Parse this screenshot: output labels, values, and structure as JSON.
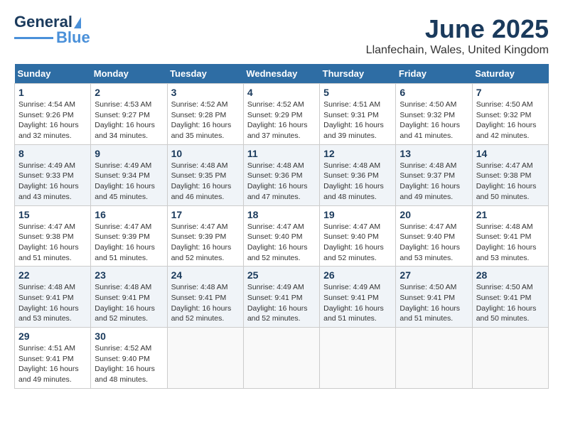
{
  "header": {
    "logo_general": "General",
    "logo_blue": "Blue",
    "month_title": "June 2025",
    "location": "Llanfechain, Wales, United Kingdom"
  },
  "weekdays": [
    "Sunday",
    "Monday",
    "Tuesday",
    "Wednesday",
    "Thursday",
    "Friday",
    "Saturday"
  ],
  "weeks": [
    [
      {
        "day": "1",
        "sunrise": "4:54 AM",
        "sunset": "9:26 PM",
        "daylight": "16 hours and 32 minutes."
      },
      {
        "day": "2",
        "sunrise": "4:53 AM",
        "sunset": "9:27 PM",
        "daylight": "16 hours and 34 minutes."
      },
      {
        "day": "3",
        "sunrise": "4:52 AM",
        "sunset": "9:28 PM",
        "daylight": "16 hours and 35 minutes."
      },
      {
        "day": "4",
        "sunrise": "4:52 AM",
        "sunset": "9:29 PM",
        "daylight": "16 hours and 37 minutes."
      },
      {
        "day": "5",
        "sunrise": "4:51 AM",
        "sunset": "9:31 PM",
        "daylight": "16 hours and 39 minutes."
      },
      {
        "day": "6",
        "sunrise": "4:50 AM",
        "sunset": "9:32 PM",
        "daylight": "16 hours and 41 minutes."
      },
      {
        "day": "7",
        "sunrise": "4:50 AM",
        "sunset": "9:32 PM",
        "daylight": "16 hours and 42 minutes."
      }
    ],
    [
      {
        "day": "8",
        "sunrise": "4:49 AM",
        "sunset": "9:33 PM",
        "daylight": "16 hours and 43 minutes."
      },
      {
        "day": "9",
        "sunrise": "4:49 AM",
        "sunset": "9:34 PM",
        "daylight": "16 hours and 45 minutes."
      },
      {
        "day": "10",
        "sunrise": "4:48 AM",
        "sunset": "9:35 PM",
        "daylight": "16 hours and 46 minutes."
      },
      {
        "day": "11",
        "sunrise": "4:48 AM",
        "sunset": "9:36 PM",
        "daylight": "16 hours and 47 minutes."
      },
      {
        "day": "12",
        "sunrise": "4:48 AM",
        "sunset": "9:36 PM",
        "daylight": "16 hours and 48 minutes."
      },
      {
        "day": "13",
        "sunrise": "4:48 AM",
        "sunset": "9:37 PM",
        "daylight": "16 hours and 49 minutes."
      },
      {
        "day": "14",
        "sunrise": "4:47 AM",
        "sunset": "9:38 PM",
        "daylight": "16 hours and 50 minutes."
      }
    ],
    [
      {
        "day": "15",
        "sunrise": "4:47 AM",
        "sunset": "9:38 PM",
        "daylight": "16 hours and 51 minutes."
      },
      {
        "day": "16",
        "sunrise": "4:47 AM",
        "sunset": "9:39 PM",
        "daylight": "16 hours and 51 minutes."
      },
      {
        "day": "17",
        "sunrise": "4:47 AM",
        "sunset": "9:39 PM",
        "daylight": "16 hours and 52 minutes."
      },
      {
        "day": "18",
        "sunrise": "4:47 AM",
        "sunset": "9:40 PM",
        "daylight": "16 hours and 52 minutes."
      },
      {
        "day": "19",
        "sunrise": "4:47 AM",
        "sunset": "9:40 PM",
        "daylight": "16 hours and 52 minutes."
      },
      {
        "day": "20",
        "sunrise": "4:47 AM",
        "sunset": "9:40 PM",
        "daylight": "16 hours and 53 minutes."
      },
      {
        "day": "21",
        "sunrise": "4:48 AM",
        "sunset": "9:41 PM",
        "daylight": "16 hours and 53 minutes."
      }
    ],
    [
      {
        "day": "22",
        "sunrise": "4:48 AM",
        "sunset": "9:41 PM",
        "daylight": "16 hours and 53 minutes."
      },
      {
        "day": "23",
        "sunrise": "4:48 AM",
        "sunset": "9:41 PM",
        "daylight": "16 hours and 52 minutes."
      },
      {
        "day": "24",
        "sunrise": "4:48 AM",
        "sunset": "9:41 PM",
        "daylight": "16 hours and 52 minutes."
      },
      {
        "day": "25",
        "sunrise": "4:49 AM",
        "sunset": "9:41 PM",
        "daylight": "16 hours and 52 minutes."
      },
      {
        "day": "26",
        "sunrise": "4:49 AM",
        "sunset": "9:41 PM",
        "daylight": "16 hours and 51 minutes."
      },
      {
        "day": "27",
        "sunrise": "4:50 AM",
        "sunset": "9:41 PM",
        "daylight": "16 hours and 51 minutes."
      },
      {
        "day": "28",
        "sunrise": "4:50 AM",
        "sunset": "9:41 PM",
        "daylight": "16 hours and 50 minutes."
      }
    ],
    [
      {
        "day": "29",
        "sunrise": "4:51 AM",
        "sunset": "9:41 PM",
        "daylight": "16 hours and 49 minutes."
      },
      {
        "day": "30",
        "sunrise": "4:52 AM",
        "sunset": "9:40 PM",
        "daylight": "16 hours and 48 minutes."
      },
      null,
      null,
      null,
      null,
      null
    ]
  ]
}
